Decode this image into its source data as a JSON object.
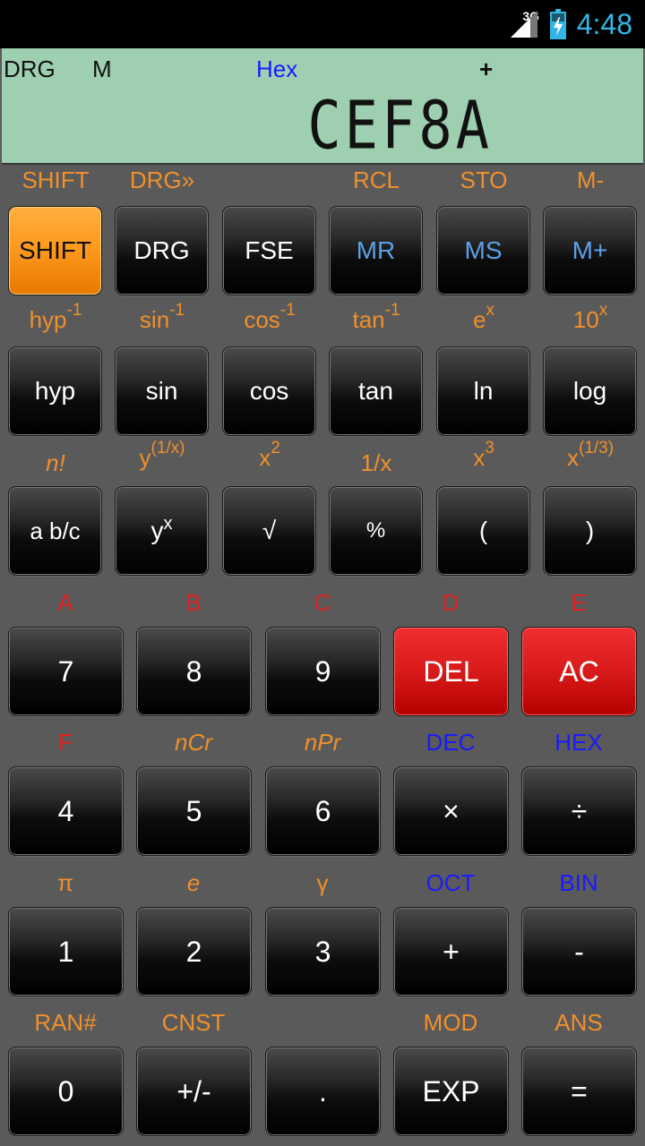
{
  "status": {
    "network": "3G",
    "time": "4:48"
  },
  "display": {
    "angle_mode": "DRG",
    "memory": "M",
    "number_base": "Hex",
    "sign": "+",
    "value": "CEF8A"
  },
  "row1": {
    "labels": [
      "SHIFT",
      "DRG»",
      "",
      "RCL",
      "STO",
      "M-"
    ],
    "keys": [
      "SHIFT",
      "DRG",
      "FSE",
      "MR",
      "MS",
      "M+"
    ]
  },
  "row2": {
    "labels": [
      {
        "base": "hyp",
        "sup": "-1"
      },
      {
        "base": "sin",
        "sup": "-1"
      },
      {
        "base": "cos",
        "sup": "-1"
      },
      {
        "base": "tan",
        "sup": "-1"
      },
      {
        "base": "e",
        "sup": "x"
      },
      {
        "base": "10",
        "sup": "x"
      }
    ],
    "keys": [
      "hyp",
      "sin",
      "cos",
      "tan",
      "ln",
      "log"
    ]
  },
  "row3": {
    "labels": [
      {
        "base": "n!",
        "sup": ""
      },
      {
        "base": "y",
        "sup": "(1/x)"
      },
      {
        "base": "x",
        "sup": "2"
      },
      {
        "base": "1/x",
        "sup": ""
      },
      {
        "base": "x",
        "sup": "3"
      },
      {
        "base": "x",
        "sup": "(1/3)"
      }
    ],
    "keys": [
      "a b/c",
      {
        "base": "y",
        "sup": "x"
      },
      "√",
      "%",
      "(",
      ")"
    ]
  },
  "row4": {
    "labels": [
      "A",
      "B",
      "C",
      "D",
      "E"
    ],
    "keys": [
      "7",
      "8",
      "9",
      "DEL",
      "AC"
    ]
  },
  "row5": {
    "labels": [
      "F",
      "nCr",
      "nPr",
      "DEC",
      "HEX"
    ],
    "keys": [
      "4",
      "5",
      "6",
      "×",
      "÷"
    ]
  },
  "row6": {
    "labels": [
      "π",
      "e",
      "γ",
      "OCT",
      "BIN"
    ],
    "keys": [
      "1",
      "2",
      "3",
      "+",
      "-"
    ]
  },
  "row7": {
    "labels": [
      "RAN#",
      "CNST",
      "",
      "MOD",
      "ANS"
    ],
    "keys": [
      "0",
      "+/-",
      ".",
      "EXP",
      "="
    ]
  },
  "colors": {
    "display_bg": "#9ecfb0",
    "label_orange": "#f0902a",
    "label_red": "#e02020",
    "label_blue": "#1a1aff",
    "shift_key": "#ff9a20",
    "danger_key": "#d81a1a",
    "memory_key_text": "#5aa0e8"
  }
}
